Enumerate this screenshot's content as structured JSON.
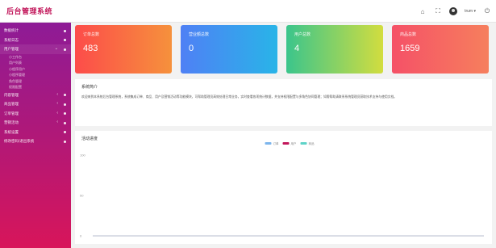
{
  "header": {
    "brand": "后台管理系统",
    "user_name": "trum ▾",
    "icons": [
      "home-icon",
      "fullscreen-icon",
      "avatar",
      "power-icon"
    ],
    "icon_glyphs": {
      "home": "⌂",
      "fullscreen": "⛶",
      "power": "⏻"
    }
  },
  "sidebar": {
    "items": [
      {
        "label": "数据统计",
        "dot": true
      },
      {
        "label": "系统日志",
        "dot": true
      },
      {
        "label": "用户管理",
        "arrow": "⌄",
        "dot": true,
        "open": true,
        "children": [
          "小工作台",
          "用户列表",
          "小程序用户",
          "小程序管理",
          "角色管理",
          "权限配置"
        ]
      },
      {
        "label": "内容管理",
        "arrow": "‹",
        "dot": true
      },
      {
        "label": "商品管理",
        "arrow": "‹",
        "dot": true
      },
      {
        "label": "订单管理",
        "arrow": "‹",
        "dot": true
      },
      {
        "label": "营销活动",
        "arrow": "‹",
        "dot": true
      },
      {
        "label": "系统设置",
        "dot": true
      },
      {
        "label": "修改密码/退出系统",
        "dot": true
      }
    ]
  },
  "cards": [
    {
      "title": "订单总数",
      "value": "483"
    },
    {
      "title": "营业额总数",
      "value": "0"
    },
    {
      "title": "用户总数",
      "value": "4"
    },
    {
      "title": "商品总数",
      "value": "1659"
    }
  ],
  "about": {
    "title": "系统简介",
    "text": "欢迎来到本系统后台管理系统，系统集成订单、商品、用户及营销活动等功能模块，可帮助管理员高效处理日常业务，实时查看各项统计数据，并支持权限配置与多角色协同管理；如需帮助请联系系统管理员获取技术支持与使用文档。"
  },
  "chart_data": {
    "type": "line",
    "title": "活动进度",
    "series": [
      {
        "name": "订单",
        "color": "#7cb5ec",
        "values": [
          0,
          0,
          0,
          0,
          0,
          0,
          0
        ]
      },
      {
        "name": "用户",
        "color": "#c2185b",
        "values": [
          0,
          0,
          0,
          0,
          0,
          0,
          0
        ]
      },
      {
        "name": "商品",
        "color": "#5ed3c8",
        "values": [
          0,
          0,
          0,
          0,
          0,
          0,
          0
        ]
      }
    ],
    "x": [
      "",
      "",
      "",
      "",
      "",
      "",
      ""
    ],
    "yticks": [
      "100",
      "50",
      "0"
    ],
    "ylim": [
      0,
      100
    ],
    "legend": "top-center",
    "grid": false
  }
}
